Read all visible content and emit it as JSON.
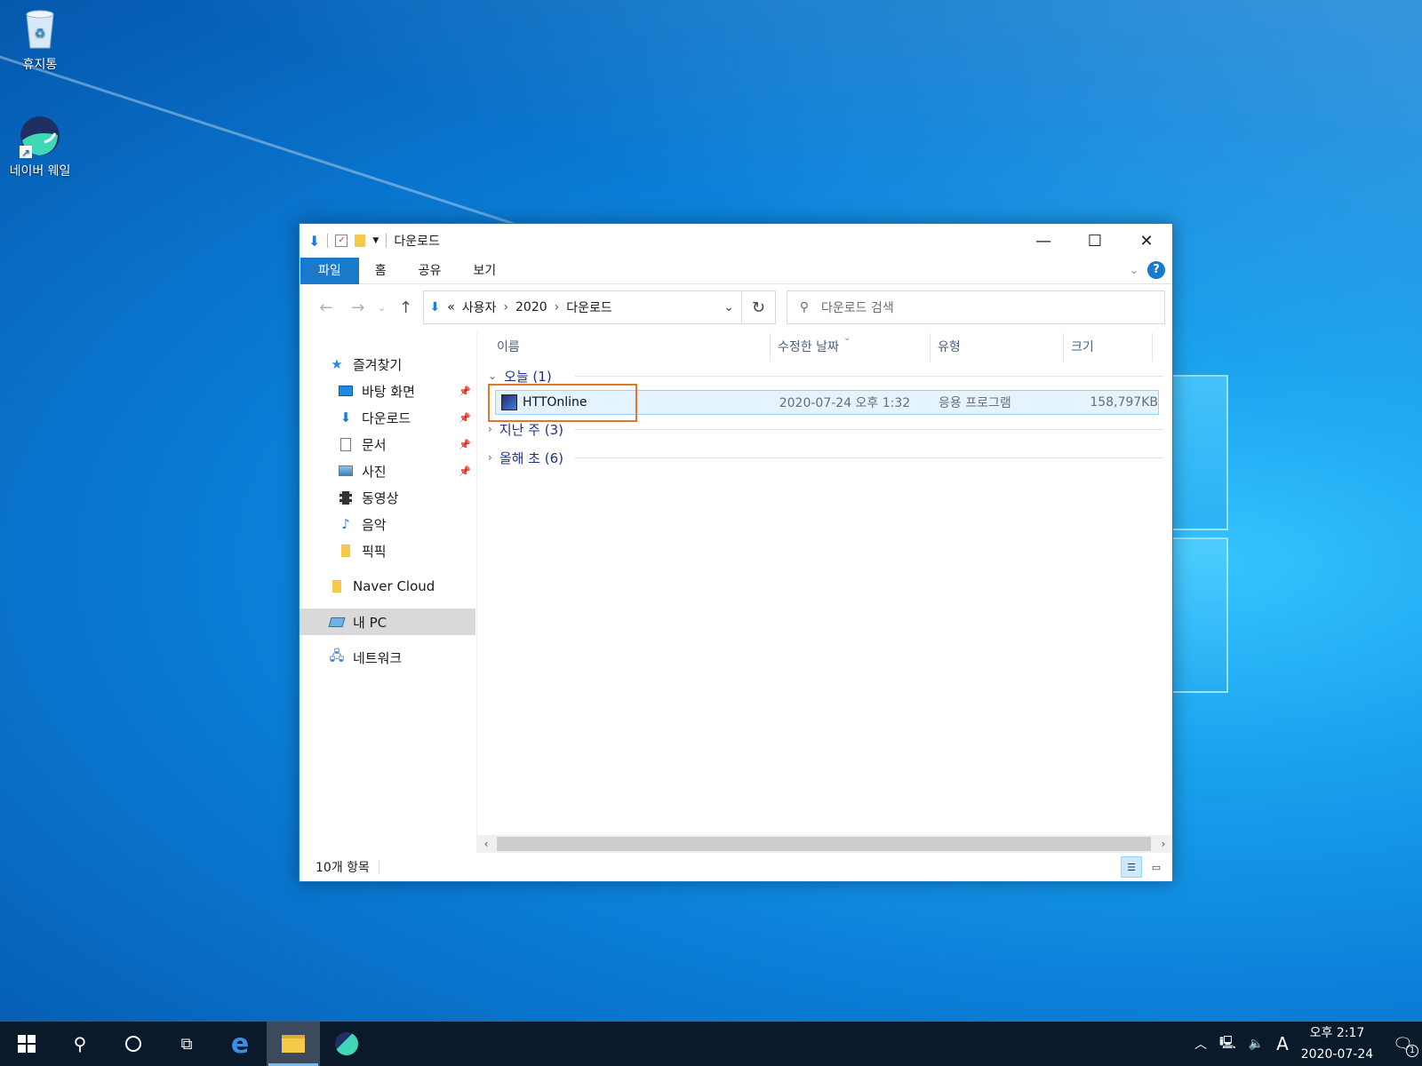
{
  "desktop": {
    "icons": [
      {
        "label": "휴지통"
      },
      {
        "label": "네이버 웨일"
      }
    ]
  },
  "window": {
    "title": "다운로드",
    "ribbon_tabs": [
      "파일",
      "홈",
      "공유",
      "보기"
    ],
    "help": "?",
    "address": {
      "prefix": "«",
      "crumbs": [
        "사용자",
        "2020",
        "다운로드"
      ]
    },
    "search_placeholder": "다운로드 검색",
    "sidebar": {
      "favorites": "즐겨찾기",
      "pinned": [
        {
          "label": "바탕 화면",
          "icon": "desktop-icon"
        },
        {
          "label": "다운로드",
          "icon": "download-icon"
        },
        {
          "label": "문서",
          "icon": "document-icon"
        },
        {
          "label": "사진",
          "icon": "picture-icon"
        }
      ],
      "others": [
        {
          "label": "동영상",
          "icon": "video-icon"
        },
        {
          "label": "음악",
          "icon": "music-icon"
        },
        {
          "label": "픽픽",
          "icon": "folder-icon"
        }
      ],
      "naver_cloud": "Naver Cloud",
      "this_pc": "내 PC",
      "network": "네트워크"
    },
    "columns": [
      "이름",
      "수정한 날짜",
      "유형",
      "크기"
    ],
    "groups": {
      "today": "오늘 (1)",
      "last_week": "지난 주 (3)",
      "this_year": "올해 초 (6)"
    },
    "file": {
      "name": "HTTOnline",
      "date": "2020-07-24 오후 1:32",
      "type": "응용 프로그램",
      "size": "158,797KB"
    },
    "status": "10개 항목"
  },
  "taskbar": {
    "ime": "A",
    "time": "오후 2:17",
    "date": "2020-07-24",
    "notification_count": "1"
  }
}
